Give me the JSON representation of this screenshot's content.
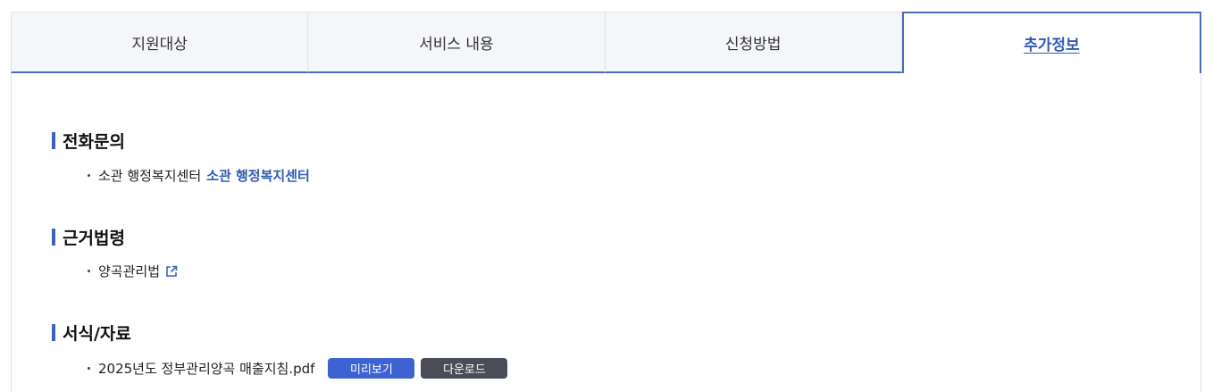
{
  "tabs": [
    {
      "label": "지원대상"
    },
    {
      "label": "서비스 내용"
    },
    {
      "label": "신청방법"
    },
    {
      "label": "추가정보"
    }
  ],
  "active_tab": "추가정보",
  "sections": {
    "contact": {
      "title": "전화문의",
      "item_text": "소관 행정복지센터",
      "item_link": "소관 행정복지센터"
    },
    "law": {
      "title": "근거법령",
      "item_text": "양곡관리법",
      "icon": "external-link-icon"
    },
    "forms": {
      "title": "서식/자료",
      "file_name": "2025년도 정부관리양곡 매출지침.pdf",
      "preview_label": "미리보기",
      "download_label": "다운로드"
    }
  },
  "colors": {
    "accent": "#3d63b8",
    "tab_bg": "#f5f6f9",
    "preview_button": "#3d63d1",
    "download_button": "#4a4d57"
  }
}
